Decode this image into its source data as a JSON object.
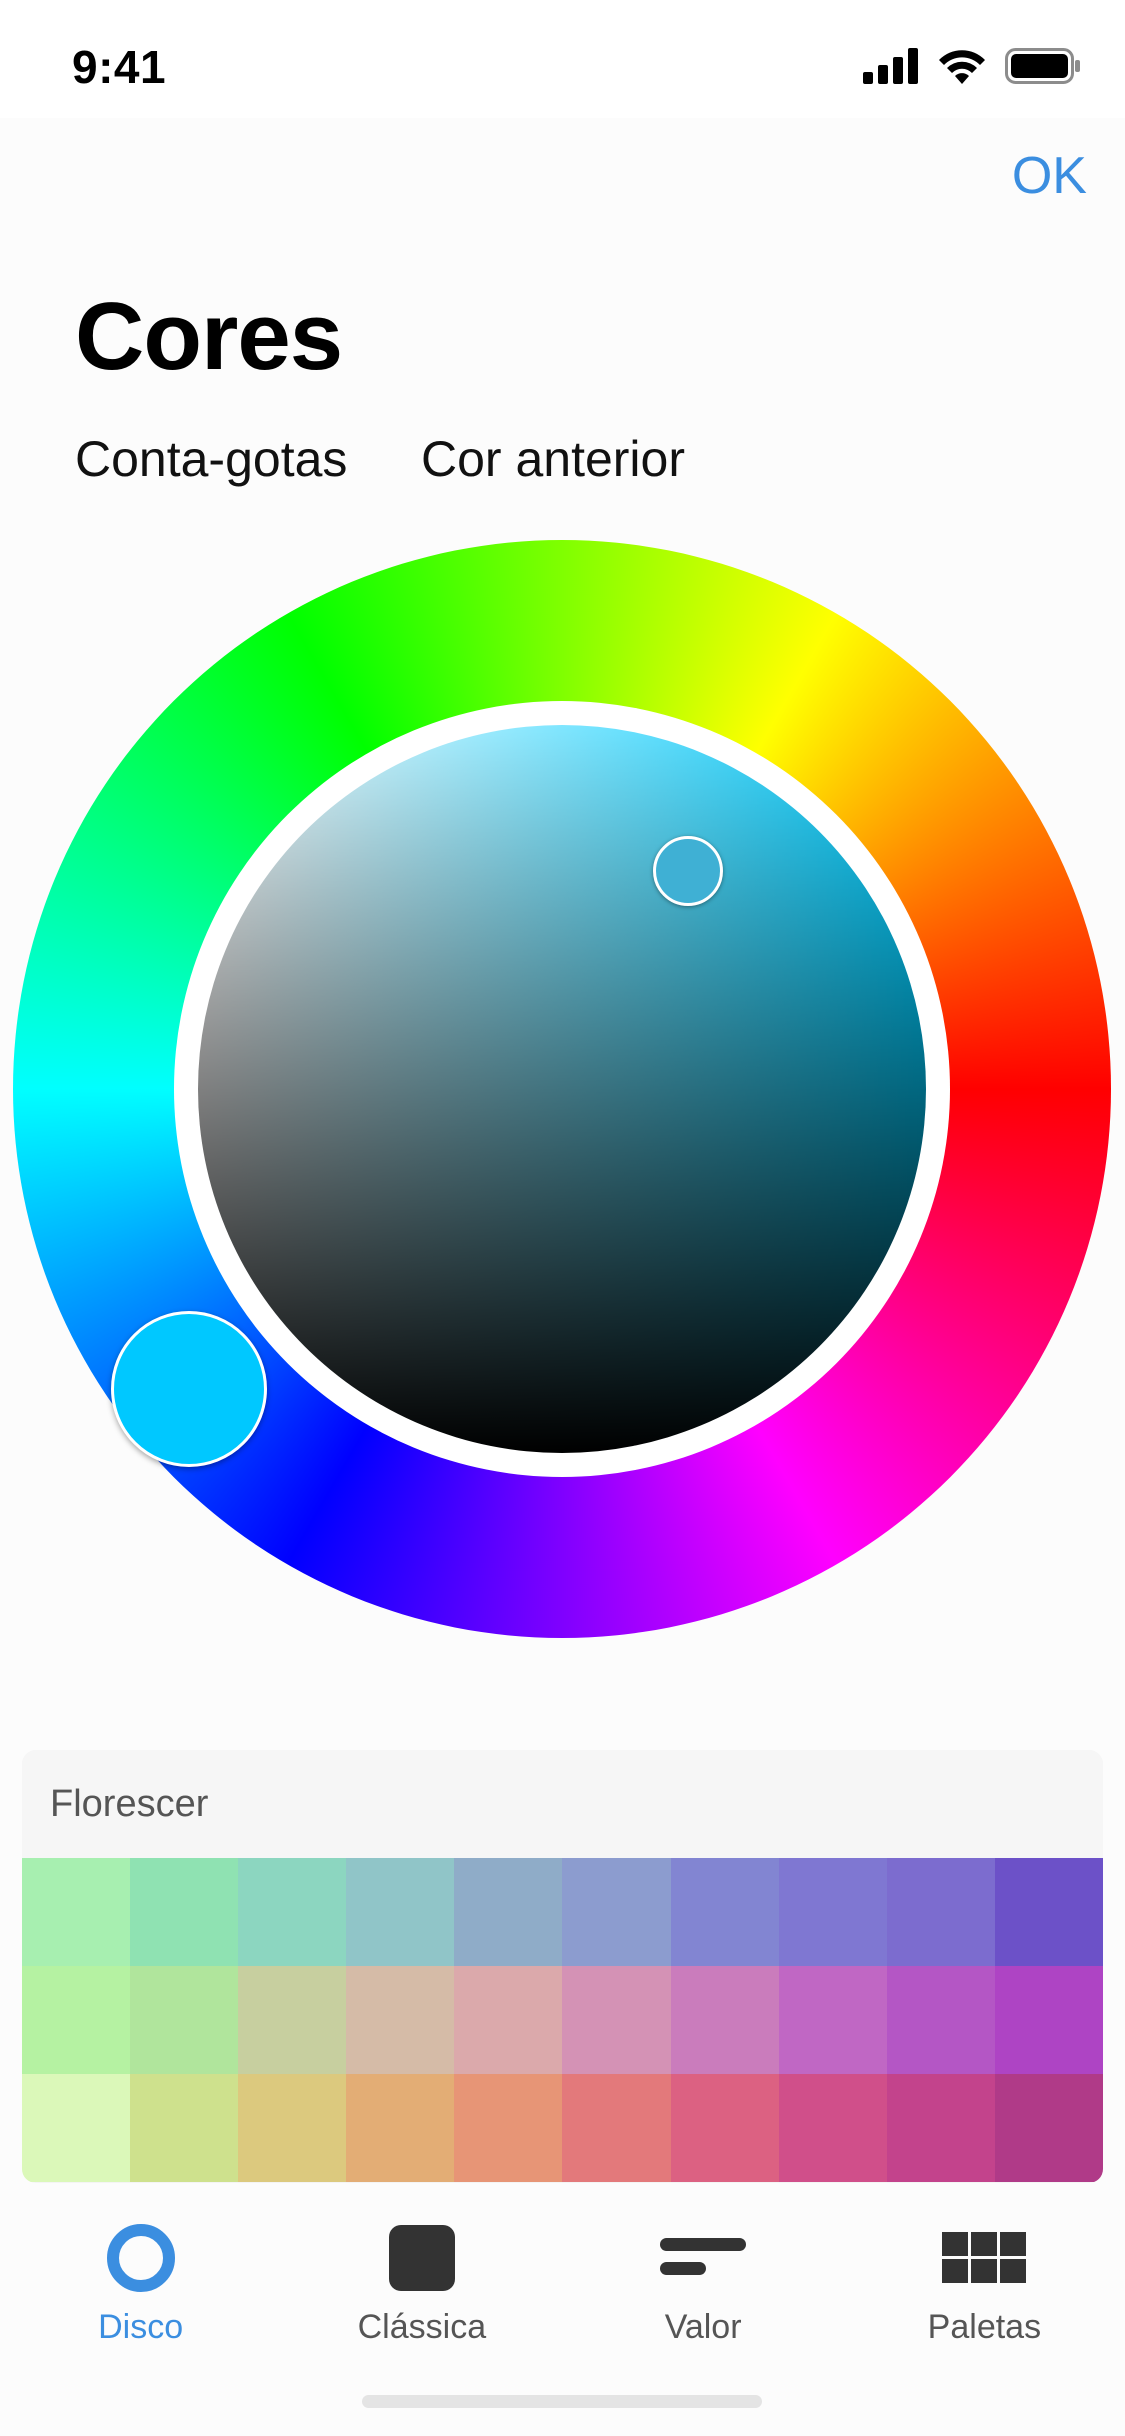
{
  "status_bar": {
    "time": "9:41"
  },
  "header": {
    "ok_label": "OK",
    "title": "Cores"
  },
  "tools": {
    "eyedropper_label": "Conta-gotas",
    "previous_color_label": "Cor anterior"
  },
  "wheel": {
    "selected_hue_color": "#00c8ff",
    "selected_color": "#3fb0d4"
  },
  "palette": {
    "name": "Florescer",
    "rows": [
      [
        "#a7efb0",
        "#8fe2b2",
        "#8cd6c0",
        "#90c5c8",
        "#8facc8",
        "#8c9ccf",
        "#8285d2",
        "#7f77d2",
        "#7c6ccf",
        "#6c51c8"
      ],
      [
        "#b5f2a2",
        "#b0e59c",
        "#c7cf9f",
        "#d5bba7",
        "#dba9ab",
        "#d492b5",
        "#ca7cbc",
        "#c067c4",
        "#b456c5",
        "#ae44c4"
      ],
      [
        "#dbf8b9",
        "#cee18d",
        "#dcc97e",
        "#e3ad75",
        "#e79576",
        "#e3797b",
        "#dc6182",
        "#d04f8a",
        "#c3438c",
        "#b03a88"
      ]
    ]
  },
  "tabbar": {
    "tabs": [
      {
        "label": "Disco",
        "icon": "disc-icon",
        "active": true
      },
      {
        "label": "Clássica",
        "icon": "square-icon",
        "active": false
      },
      {
        "label": "Valor",
        "icon": "sliders-icon",
        "active": false
      },
      {
        "label": "Paletas",
        "icon": "grid-icon",
        "active": false
      }
    ],
    "active_color": "#3b8ee0",
    "inactive_color": "#333333"
  }
}
